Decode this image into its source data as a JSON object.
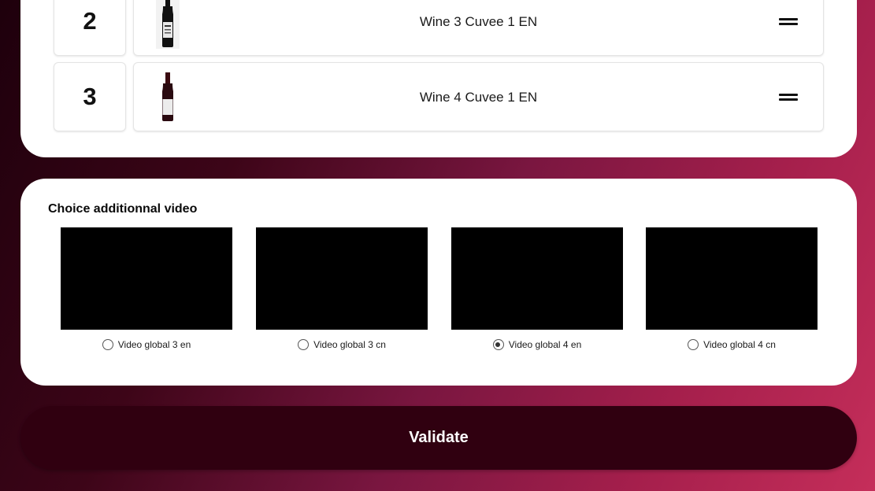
{
  "ranking": {
    "rows": [
      {
        "number": "2",
        "label": "Wine 3 Cuvee 1 EN",
        "bottle_icon": "wine-bottle-dark-label-icon"
      },
      {
        "number": "3",
        "label": "Wine 4 Cuvee 1 EN",
        "bottle_icon": "wine-bottle-white-label-icon"
      }
    ],
    "drag_icon": "drag-handle-icon"
  },
  "video_section": {
    "title": "Choice additionnal video",
    "options": [
      {
        "label": "Video global 3 en",
        "checked": false
      },
      {
        "label": "Video global 3 cn",
        "checked": false
      },
      {
        "label": "Video global 4 en",
        "checked": true
      },
      {
        "label": "Video global 4 cn",
        "checked": false
      }
    ]
  },
  "validate_button": {
    "label": "Validate"
  },
  "colors": {
    "card_bg": "#ffffff",
    "button_bg": "#300010",
    "gradient_start": "#1e000c",
    "gradient_end": "#c52e5a"
  }
}
